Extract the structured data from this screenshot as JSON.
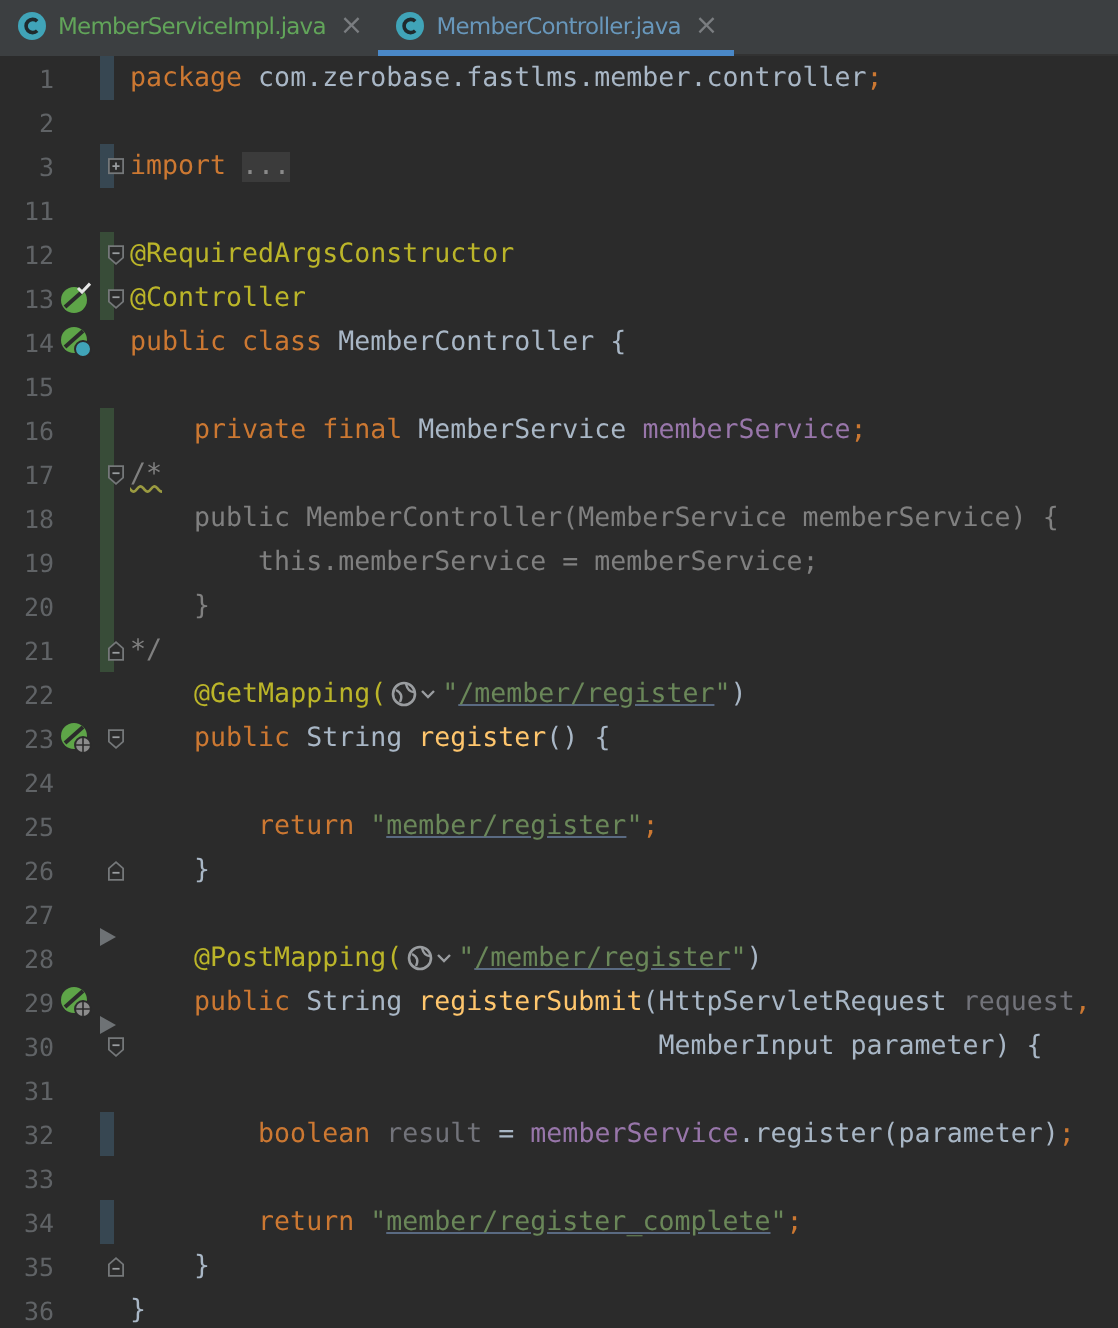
{
  "tabs": [
    {
      "label": "MemberServiceImpl.java",
      "kind": "added",
      "selected": false,
      "close": "×"
    },
    {
      "label": "MemberController.java",
      "kind": "modified",
      "selected": true,
      "close": "×"
    }
  ],
  "lines": [
    {
      "number": "1",
      "change": {
        "kind": "modified"
      },
      "tokens": [
        {
          "t": "package",
          "kind": "kw"
        },
        {
          "t": " com.zerobase.fastlms.member.controller",
          "kind": "plain"
        },
        {
          "t": ";",
          "kind": "kw"
        }
      ]
    },
    {
      "number": "2"
    },
    {
      "number": "3",
      "change": {
        "kind": "modified"
      },
      "fold": {
        "kind": "expand"
      },
      "tokens": [
        {
          "t": "import ",
          "kind": "kw"
        },
        {
          "t": "...",
          "kind": "folded"
        }
      ]
    },
    {
      "number": "11"
    },
    {
      "number": "12",
      "change": {
        "kind": "added"
      },
      "fold": {
        "kind": "start"
      },
      "tokens": [
        {
          "t": "@RequiredArgsConstructor",
          "kind": "ann"
        }
      ]
    },
    {
      "number": "13",
      "change": {
        "kind": "added"
      },
      "fold": {
        "kind": "start"
      },
      "gutter": {
        "kind": "bean-check"
      },
      "tokens": [
        {
          "t": "@Controller",
          "kind": "ann"
        }
      ]
    },
    {
      "number": "14",
      "gutter": {
        "kind": "bean-class"
      },
      "tokens": [
        {
          "t": "public class ",
          "kind": "kw"
        },
        {
          "t": "MemberController {",
          "kind": "plain"
        }
      ]
    },
    {
      "number": "15"
    },
    {
      "number": "16",
      "change": {
        "kind": "added"
      },
      "tokens": [
        {
          "t": "    private final ",
          "kind": "kw"
        },
        {
          "t": "MemberService ",
          "kind": "plain"
        },
        {
          "t": "memberService",
          "kind": "field"
        },
        {
          "t": ";",
          "kind": "kw"
        }
      ]
    },
    {
      "number": "17",
      "change": {
        "kind": "added"
      },
      "fold": {
        "kind": "start"
      },
      "tokens": [
        {
          "t": "/*",
          "kind": "typo"
        }
      ]
    },
    {
      "number": "18",
      "change": {
        "kind": "added"
      },
      "tokens": [
        {
          "t": "    public MemberController(MemberService memberService) {",
          "kind": "comment"
        }
      ]
    },
    {
      "number": "19",
      "change": {
        "kind": "added"
      },
      "tokens": [
        {
          "t": "        this.memberService = memberService;",
          "kind": "comment"
        }
      ]
    },
    {
      "number": "20",
      "change": {
        "kind": "added"
      },
      "tokens": [
        {
          "t": "    }",
          "kind": "comment"
        }
      ]
    },
    {
      "number": "21",
      "change": {
        "kind": "added"
      },
      "fold": {
        "kind": "end"
      },
      "tokens": [
        {
          "t": "*/",
          "kind": "comment"
        }
      ]
    },
    {
      "number": "22",
      "tokens": [
        {
          "t": "    @GetMapping(",
          "kind": "ann"
        },
        {
          "kind": "inlay"
        },
        {
          "t": "\"",
          "kind": "str"
        },
        {
          "t": "/member/register",
          "kind": "link"
        },
        {
          "t": "\"",
          "kind": "str"
        },
        {
          "t": ")",
          "kind": "plain"
        }
      ]
    },
    {
      "number": "23",
      "gutter": {
        "kind": "bean-web"
      },
      "fold": {
        "kind": "start"
      },
      "tokens": [
        {
          "t": "    public ",
          "kind": "kw"
        },
        {
          "t": "String ",
          "kind": "plain"
        },
        {
          "t": "register",
          "kind": "method"
        },
        {
          "t": "() {",
          "kind": "plain"
        }
      ]
    },
    {
      "number": "24"
    },
    {
      "number": "25",
      "tokens": [
        {
          "t": "        return ",
          "kind": "kw"
        },
        {
          "t": "\"",
          "kind": "str"
        },
        {
          "t": "member/register",
          "kind": "link"
        },
        {
          "t": "\"",
          "kind": "str"
        },
        {
          "t": ";",
          "kind": "kw"
        }
      ]
    },
    {
      "number": "26",
      "fold": {
        "kind": "end"
      },
      "tokens": [
        {
          "t": "    }",
          "kind": "plain"
        }
      ]
    },
    {
      "number": "27"
    },
    {
      "number": "28",
      "arrow": true,
      "tokens": [
        {
          "t": "    @PostMapping(",
          "kind": "ann"
        },
        {
          "kind": "inlay"
        },
        {
          "t": "\"",
          "kind": "str"
        },
        {
          "t": "/member/register",
          "kind": "link"
        },
        {
          "t": "\"",
          "kind": "str"
        },
        {
          "t": ")",
          "kind": "plain"
        }
      ]
    },
    {
      "number": "29",
      "gutter": {
        "kind": "bean-web"
      },
      "tokens": [
        {
          "t": "    public ",
          "kind": "kw"
        },
        {
          "t": "String ",
          "kind": "plain"
        },
        {
          "t": "registerSubmit",
          "kind": "method"
        },
        {
          "t": "(HttpServletRequest ",
          "kind": "plain"
        },
        {
          "t": "request",
          "kind": "unused"
        },
        {
          "t": ",",
          "kind": "kw"
        }
      ]
    },
    {
      "number": "30",
      "arrow": true,
      "fold": {
        "kind": "start"
      },
      "tokens": [
        {
          "t": "                                 MemberInput parameter) {",
          "kind": "plain"
        }
      ]
    },
    {
      "number": "31"
    },
    {
      "number": "32",
      "change": {
        "kind": "modified"
      },
      "tokens": [
        {
          "t": "        boolean ",
          "kind": "kw"
        },
        {
          "t": "result",
          "kind": "unused"
        },
        {
          "t": " = ",
          "kind": "plain"
        },
        {
          "t": "memberService",
          "kind": "field"
        },
        {
          "t": ".register(parameter)",
          "kind": "plain"
        },
        {
          "t": ";",
          "kind": "kw"
        }
      ]
    },
    {
      "number": "33"
    },
    {
      "number": "34",
      "change": {
        "kind": "modified"
      },
      "tokens": [
        {
          "t": "        return ",
          "kind": "kw"
        },
        {
          "t": "\"",
          "kind": "str"
        },
        {
          "t": "member/register_complete",
          "kind": "link"
        },
        {
          "t": "\"",
          "kind": "str"
        },
        {
          "t": ";",
          "kind": "kw"
        }
      ]
    },
    {
      "number": "35",
      "fold": {
        "kind": "end"
      },
      "tokens": [
        {
          "t": "    }",
          "kind": "plain"
        }
      ]
    },
    {
      "number": "36",
      "tokens": [
        {
          "t": "}",
          "kind": "plain"
        }
      ]
    }
  ]
}
